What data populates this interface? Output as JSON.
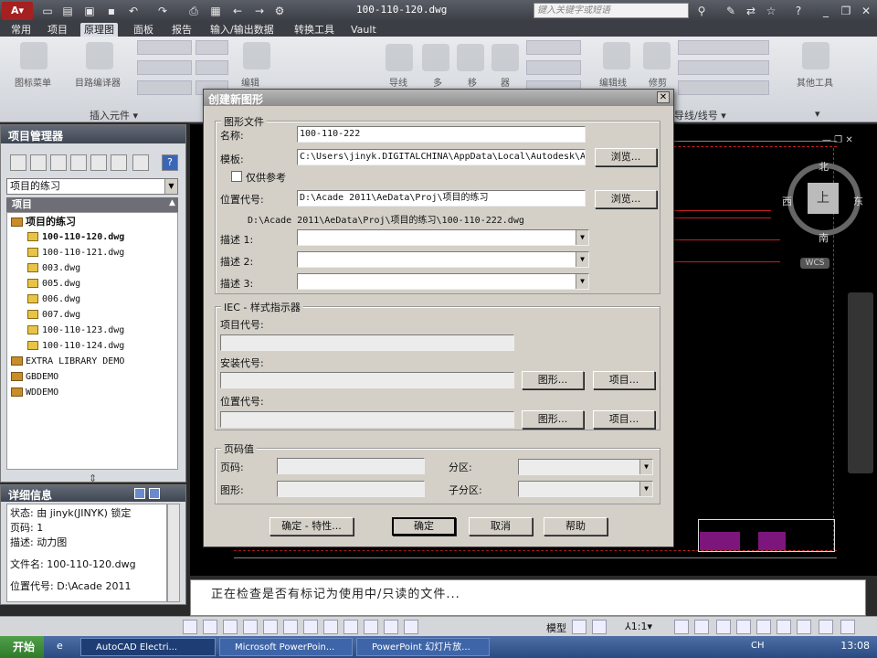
{
  "titlebar": {
    "title": "100-110-120.dwg",
    "search_placeholder": "键入关键字或短语"
  },
  "ribbon": {
    "tabs": [
      "常用",
      "项目",
      "原理图",
      "面板",
      "报告",
      "输入/输出数据",
      "转换工具",
      "Vault"
    ],
    "active_tab": "原理图",
    "group_labels": {
      "insert_components": "插入元件",
      "wire_numbers": "导线/线号",
      "other_tools": "其他工具"
    },
    "tool_labels": [
      "图标菜单",
      "目路编译器",
      "编辑",
      "导线",
      "多",
      "移",
      "器",
      "编辑线",
      "修剪"
    ]
  },
  "project_manager": {
    "title": "项目管理器",
    "selected_project": "项目的练习",
    "tree_header": "项目",
    "tree": [
      {
        "label": "项目的练习",
        "type": "folder",
        "bold": true
      },
      {
        "label": "100-110-120.dwg",
        "type": "file",
        "bold": true
      },
      {
        "label": "100-110-121.dwg",
        "type": "file"
      },
      {
        "label": "003.dwg",
        "type": "file"
      },
      {
        "label": "005.dwg",
        "type": "file"
      },
      {
        "label": "006.dwg",
        "type": "file"
      },
      {
        "label": "007.dwg",
        "type": "file"
      },
      {
        "label": "100-110-123.dwg",
        "type": "file"
      },
      {
        "label": "100-110-124.dwg",
        "type": "file"
      },
      {
        "label": "EXTRA LIBRARY DEMO",
        "type": "folder"
      },
      {
        "label": "GBDEMO",
        "type": "folder"
      },
      {
        "label": "WDDEMO",
        "type": "folder"
      }
    ]
  },
  "details": {
    "title": "详细信息",
    "lines": [
      "状态: 由 jinyk(JINYK) 锁定",
      "页码: 1",
      "描述: 动力图",
      "",
      "文件名: 100-110-120.dwg",
      "",
      "位置代号: D:\\Acade 2011"
    ]
  },
  "dialog": {
    "title": "创建新图形",
    "close_label": "✕",
    "drawing_file_group": "图形文件",
    "name_label": "名称:",
    "name_value": "100-110-222",
    "template_label": "模板:",
    "template_value": "C:\\Users\\jinyk.DIGITALCHINA\\AppData\\Local\\Autodesk\\AutoC",
    "browse_label": "浏览...",
    "ref_only_label": "仅供参考",
    "location_label": "位置代号:",
    "location_value": "D:\\Acade 2011\\AeData\\Proj\\项目的练习",
    "full_path": "D:\\Acade 2011\\AeData\\Proj\\项目的练习\\100-110-222.dwg",
    "desc1_label": "描述 1:",
    "desc2_label": "描述 2:",
    "desc3_label": "描述 3:",
    "iec_group": "IEC - 样式指示器",
    "project_code_label": "项目代号:",
    "install_code_label": "安装代号:",
    "location_code_label": "位置代号:",
    "drawing_btn": "图形...",
    "project_btn": "项目...",
    "page_group": "页码值",
    "page_label": "页码:",
    "section_label": "分区:",
    "drawing_label": "图形:",
    "subsection_label": "子分区:",
    "ok_props_btn": "确定 - 特性...",
    "ok_btn": "确定",
    "cancel_btn": "取消",
    "help_btn": "帮助"
  },
  "viewcube": {
    "north": "北",
    "south": "南",
    "east": "东",
    "west": "西",
    "top": "上",
    "wcs": "WCS"
  },
  "command_line": {
    "text": "正在检查是否有标记为使用中/只读的文件..."
  },
  "statusbar": {
    "model": "模型",
    "scale": "1:1"
  },
  "taskbar": {
    "start": "开始",
    "tasks": [
      "AutoCAD Electri...",
      "Microsoft PowerPoin...",
      "PowerPoint 幻灯片放..."
    ],
    "lang": "CH",
    "clock": "13:08"
  }
}
